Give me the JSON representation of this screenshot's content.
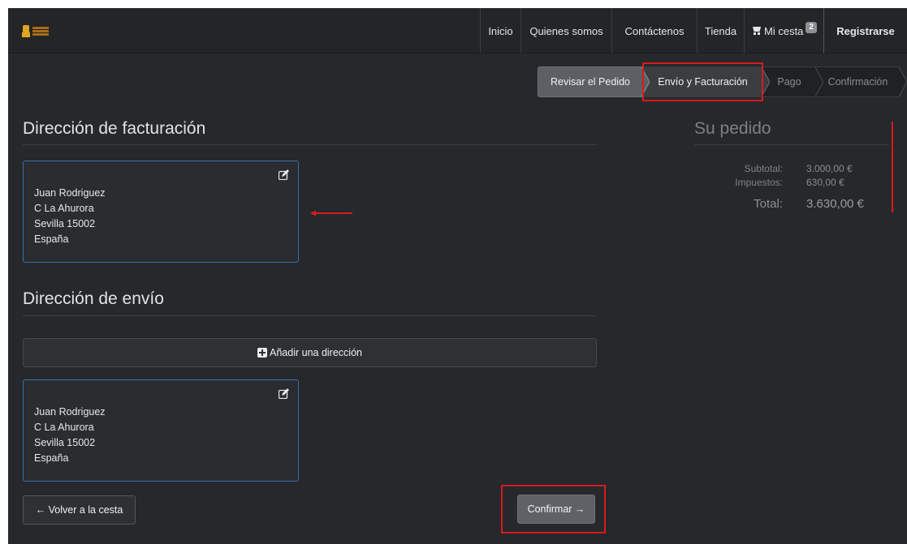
{
  "nav": {
    "items": [
      "Inicio",
      "Quienes somos",
      "Contáctenos",
      "Tienda"
    ],
    "cart_label": "Mi cesta",
    "cart_count": "2",
    "register_label": "Registrarse"
  },
  "steps": [
    "Revisar el Pedido",
    "Envío y Facturación",
    "Pago",
    "Confirmación"
  ],
  "billing": {
    "title": "Dirección de facturación",
    "address": [
      "Juan Rodriguez",
      "C La Ahurora",
      "Sevilla 15002",
      "España"
    ]
  },
  "shipping": {
    "title": "Dirección de envío",
    "add_label": "Añadir una dirección",
    "address": [
      "Juan Rodriguez",
      "C La Ahurora",
      "Sevilla 15002",
      "España"
    ]
  },
  "actions": {
    "back_label": "← Volver a la cesta",
    "confirm_label": "Confirmar →"
  },
  "summary": {
    "title": "Su pedido",
    "subtotal_label": "Subtotal:",
    "subtotal_value": "3.000,00 €",
    "tax_label": "Impuestos:",
    "tax_value": "630,00 €",
    "total_label": "Total:",
    "total_value": "3.630,00 €"
  },
  "colors": {
    "background": "#26282b",
    "navbar": "#232527",
    "card_border": "#3b6ea8",
    "annotation": "#d81b1b"
  }
}
